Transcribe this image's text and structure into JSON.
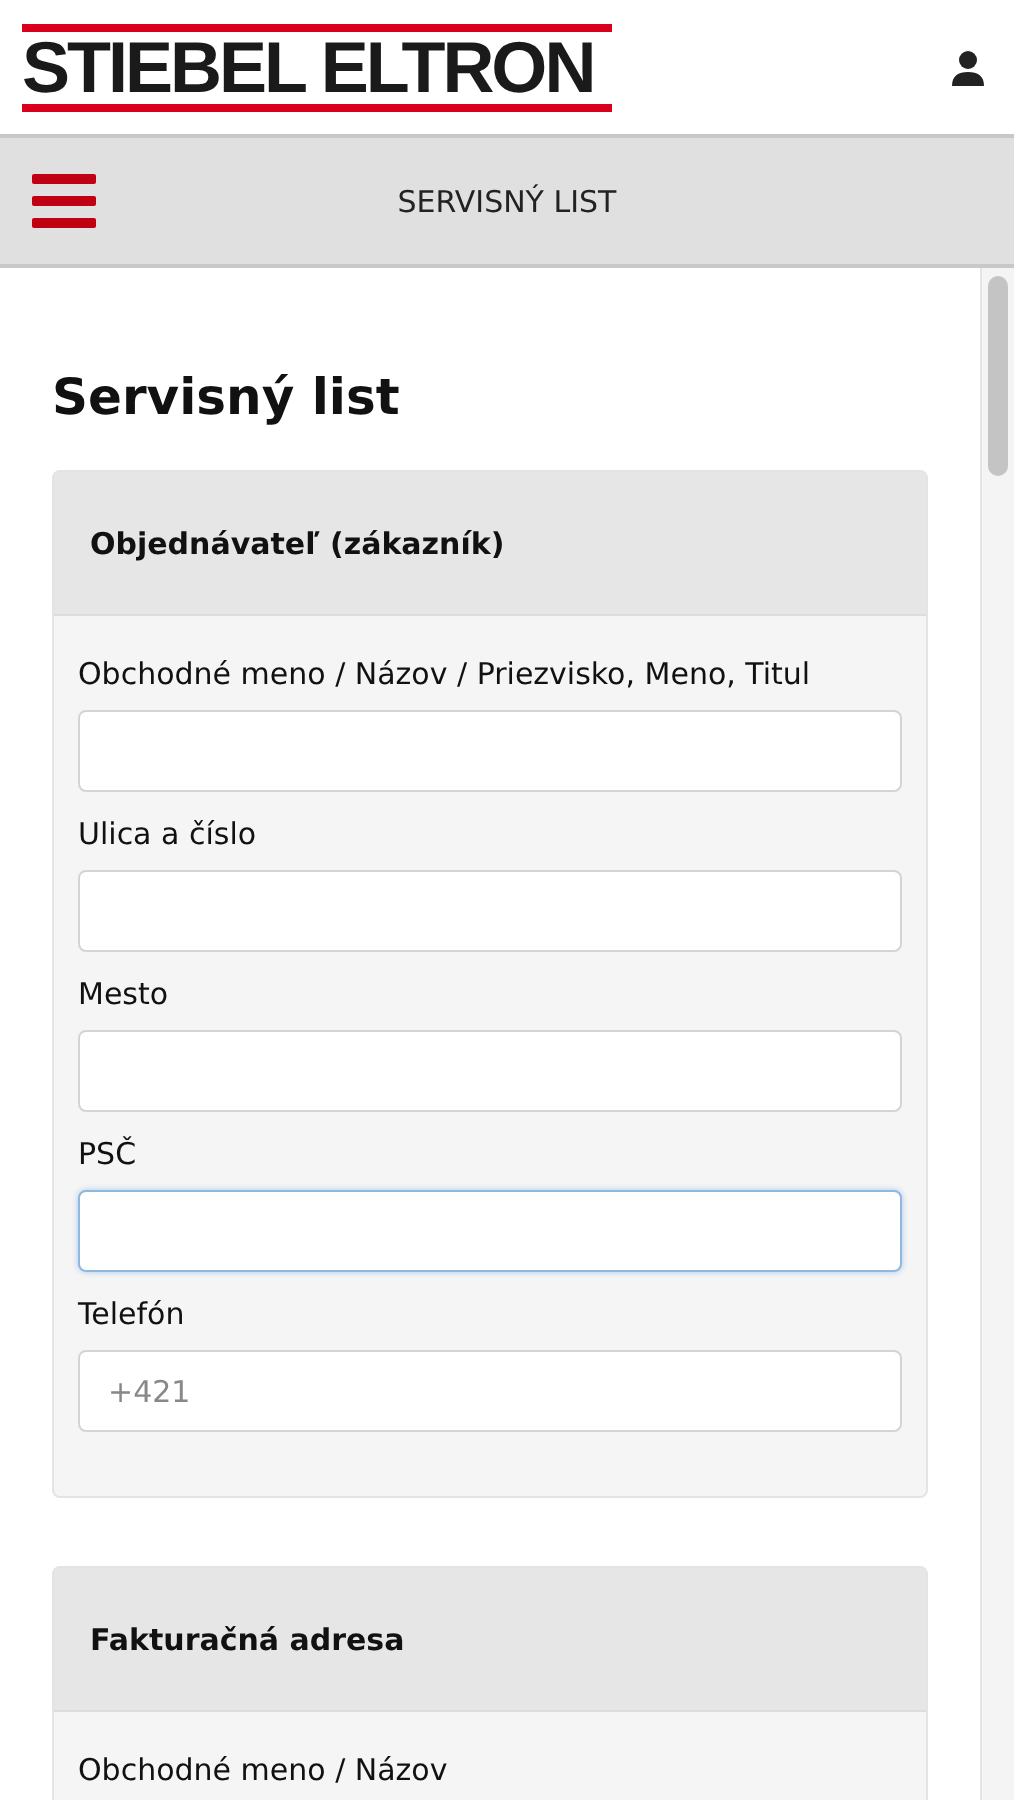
{
  "header": {
    "logo": "STIEBEL ELTRON"
  },
  "nav": {
    "title": "SERVISNÝ LIST"
  },
  "page_title": "Servisný list",
  "sections": [
    {
      "title": "Objednávateľ (zákazník)",
      "fields": [
        {
          "label": "Obchodné meno / Názov / Priezvisko, Meno, Titul",
          "focused": false
        },
        {
          "label": "Ulica a číslo",
          "focused": false
        },
        {
          "label": "Mesto",
          "focused": false
        },
        {
          "label": "PSČ",
          "focused": true
        },
        {
          "label": "Telefón",
          "placeholder": "+421",
          "focused": false
        }
      ]
    },
    {
      "title": "Fakturačná adresa",
      "fields": [
        {
          "label": "Obchodné meno / Názov"
        }
      ]
    }
  ]
}
